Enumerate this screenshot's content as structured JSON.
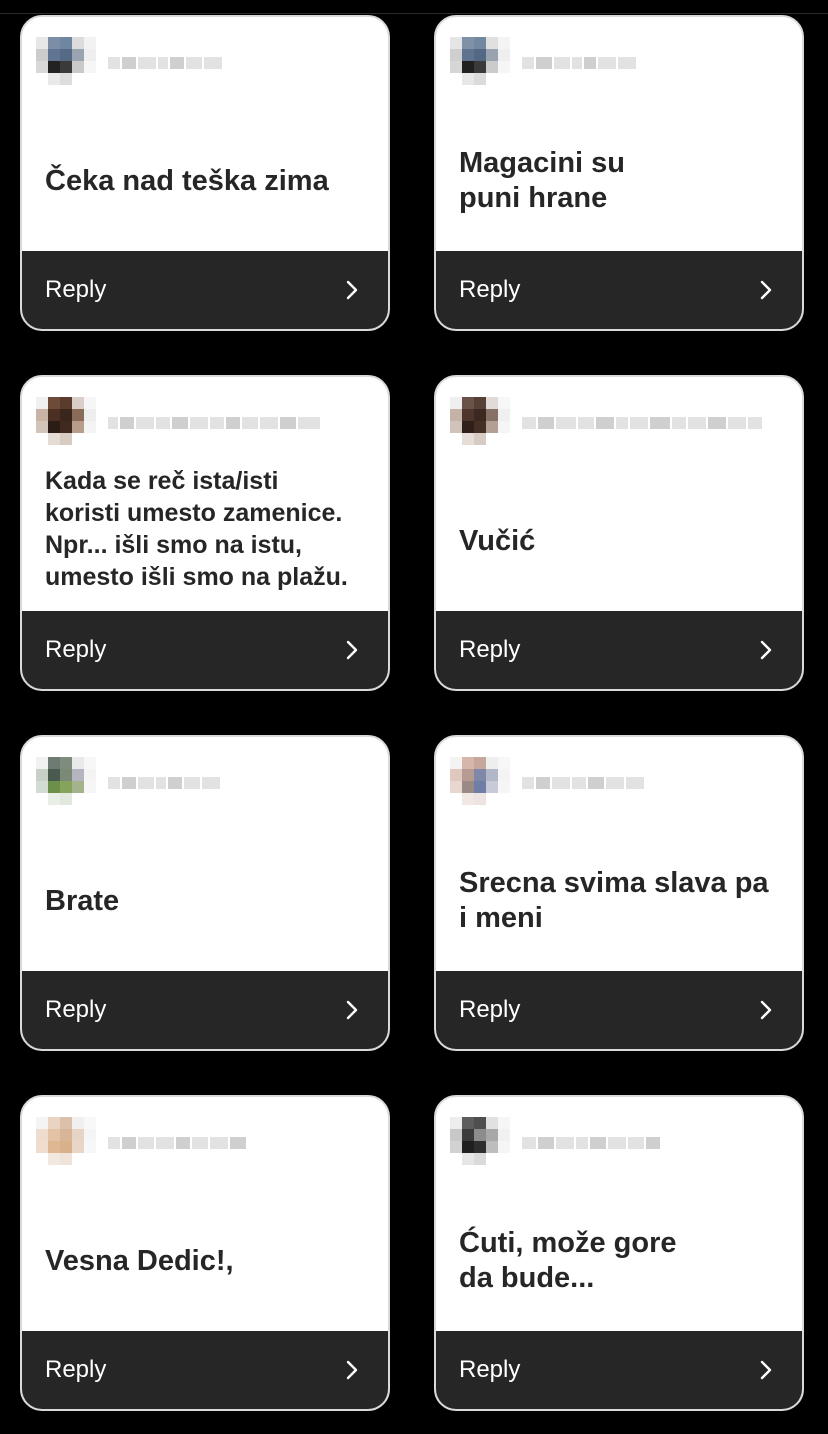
{
  "reply_label": "Reply",
  "cards": [
    {
      "text": "Čeka nad teška zima",
      "avatar_colors": [
        "#e7e7e7",
        "#7b8ea5",
        "#6f86a3",
        "#dcdcdc",
        "#f2f2f2",
        "#cccccc",
        "#5f7592",
        "#556a85",
        "#9aa4b0",
        "#eeeeee",
        "#d8d8d8",
        "#222222",
        "#3a3a3a",
        "#c9c9c9",
        "#f6f6f6",
        "#ffffff",
        "#e9e9e9",
        "#dddddd",
        "#ffffff",
        "#ffffff",
        "#ffffff",
        "#ffffff",
        "#ffffff",
        "#ffffff",
        "#ffffff"
      ],
      "name_blocks": [
        12,
        14,
        18,
        10,
        14,
        16,
        18
      ]
    },
    {
      "text": "Magacini su\npuni hrane",
      "avatar_colors": [
        "#e5e5e5",
        "#7e91a6",
        "#7288a1",
        "#e0e0e0",
        "#f4f4f4",
        "#cfcfcf",
        "#5d7390",
        "#536883",
        "#98a3af",
        "#efefef",
        "#d6d6d6",
        "#202020",
        "#3a3a3a",
        "#cbcbcb",
        "#f6f6f6",
        "#ffffff",
        "#e7e7e7",
        "#dbdbdb",
        "#ffffff",
        "#ffffff",
        "#ffffff",
        "#ffffff",
        "#ffffff",
        "#ffffff",
        "#ffffff"
      ],
      "name_blocks": [
        12,
        16,
        16,
        10,
        12,
        18,
        18
      ]
    },
    {
      "text": "Kada se reč ista/isti\nkoristi umesto zamenice.\nNpr... išli smo na istu,\numesto išli smo na plažu.",
      "small": true,
      "avatar_colors": [
        "#f0f0f0",
        "#6e4a38",
        "#5a3b2c",
        "#d9cfc8",
        "#f6f6f6",
        "#c9b3a5",
        "#4a2f22",
        "#3a261c",
        "#8a6a58",
        "#eeeeee",
        "#d3c4ba",
        "#2b1c15",
        "#402a20",
        "#b89c8c",
        "#f4f4f4",
        "#ffffff",
        "#e6dcd6",
        "#d8cbc2",
        "#ffffff",
        "#ffffff",
        "#ffffff",
        "#ffffff",
        "#ffffff",
        "#ffffff",
        "#ffffff"
      ],
      "name_blocks": [
        10,
        14,
        18,
        14,
        16,
        18,
        14,
        14,
        16,
        18,
        16,
        22
      ]
    },
    {
      "text": "Vučić",
      "avatar_colors": [
        "#efefef",
        "#6a5248",
        "#574038",
        "#e1dad6",
        "#f7f7f7",
        "#c4b1a7",
        "#4d352b",
        "#3b2820",
        "#877066",
        "#f0f0f0",
        "#d1c3bb",
        "#2f1f18",
        "#452e24",
        "#b39f94",
        "#f5f5f5",
        "#ffffff",
        "#e7ddd8",
        "#d7cbc4",
        "#ffffff",
        "#ffffff",
        "#ffffff",
        "#ffffff",
        "#ffffff",
        "#ffffff",
        "#ffffff"
      ],
      "name_blocks": [
        14,
        16,
        20,
        16,
        18,
        12,
        18,
        20,
        14,
        18,
        18,
        18,
        14
      ]
    },
    {
      "text": "Brate",
      "avatar_colors": [
        "#f1f1f1",
        "#6f7a72",
        "#7e8c7e",
        "#e9e9e9",
        "#f7f7f7",
        "#c7cfc7",
        "#4b5a4e",
        "#7a8a76",
        "#b5b5c2",
        "#f4f4f4",
        "#d3dcd3",
        "#6c8f4a",
        "#86a35c",
        "#a4b38c",
        "#f6f6f6",
        "#ffffff",
        "#e9eee6",
        "#e2e8de",
        "#ffffff",
        "#ffffff",
        "#ffffff",
        "#ffffff",
        "#ffffff",
        "#ffffff",
        "#ffffff"
      ],
      "name_blocks": [
        12,
        14,
        16,
        10,
        14,
        16,
        18
      ]
    },
    {
      "text": "Srecna svima slava pa\ni meni",
      "avatar_colors": [
        "#f3f3f3",
        "#d6b6a9",
        "#c6a79b",
        "#eeeeee",
        "#f7f7f7",
        "#e0c8be",
        "#b79b92",
        "#7f88a8",
        "#b2b7c8",
        "#f4f4f4",
        "#e8d7d0",
        "#9a8a86",
        "#6f7ea6",
        "#c7cbd8",
        "#f6f6f6",
        "#ffffff",
        "#f1e8e4",
        "#ebe4e0",
        "#ffffff",
        "#ffffff",
        "#ffffff",
        "#ffffff",
        "#ffffff",
        "#ffffff",
        "#ffffff"
      ],
      "name_blocks": [
        12,
        14,
        18,
        14,
        16,
        18,
        18
      ]
    },
    {
      "text": "Vesna Dedic!,",
      "avatar_colors": [
        "#f4f4f4",
        "#e9d3c2",
        "#dcc0aa",
        "#f0f0f0",
        "#f8f8f8",
        "#f0dccd",
        "#e3c2a6",
        "#d9b597",
        "#e8d4c4",
        "#f5f5f5",
        "#efddd0",
        "#e0b793",
        "#d9b08c",
        "#ead6c6",
        "#f7f7f7",
        "#ffffff",
        "#f2e8e0",
        "#efe3da",
        "#ffffff",
        "#ffffff",
        "#ffffff",
        "#ffffff",
        "#ffffff",
        "#ffffff",
        "#ffffff"
      ],
      "name_blocks": [
        12,
        14,
        16,
        18,
        14,
        16,
        18,
        16
      ]
    },
    {
      "text": "Ćuti, može gore\nda bude...",
      "avatar_colors": [
        "#ededed",
        "#5d5d5d",
        "#4f4f4f",
        "#e1e1e1",
        "#f6f6f6",
        "#c8c8c8",
        "#3b3b3b",
        "#8c8c8c",
        "#a8a8a8",
        "#f1f1f1",
        "#d2d2d2",
        "#1f1f1f",
        "#2e2e2e",
        "#bdbdbd",
        "#f5f5f5",
        "#ffffff",
        "#e6e6e6",
        "#dadada",
        "#ffffff",
        "#ffffff",
        "#ffffff",
        "#ffffff",
        "#ffffff",
        "#ffffff",
        "#ffffff"
      ],
      "name_blocks": [
        14,
        16,
        18,
        12,
        16,
        18,
        16,
        14
      ]
    }
  ]
}
